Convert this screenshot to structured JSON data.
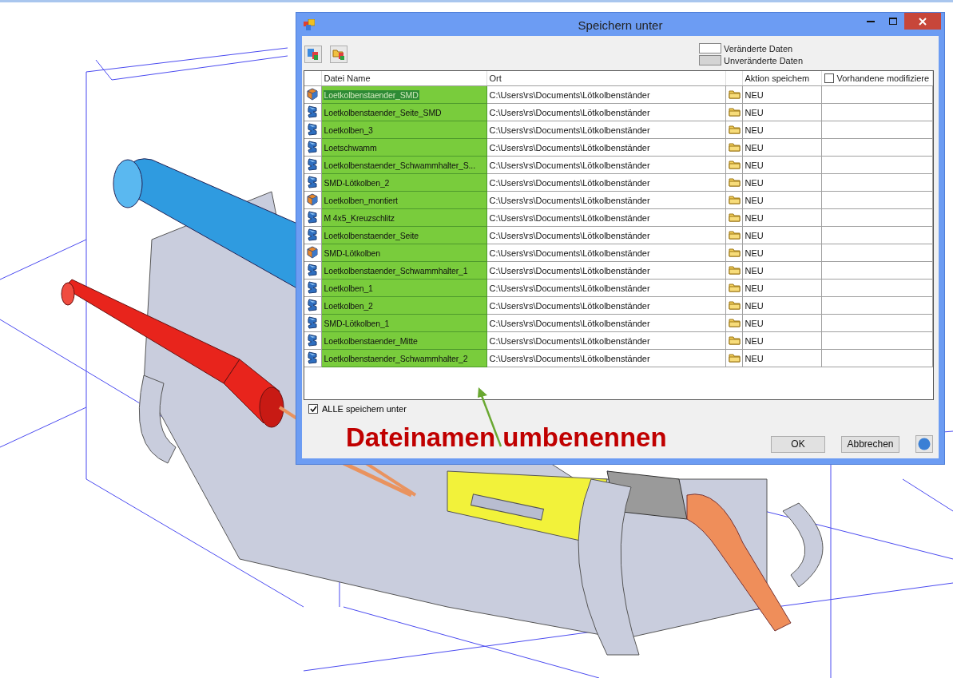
{
  "window": {
    "title": "Speichern unter"
  },
  "legend": [
    {
      "label": "Veränderte Daten",
      "color": "#ffffff"
    },
    {
      "label": "Unveränderte Daten",
      "color": "#d4d4d4"
    }
  ],
  "table": {
    "columns": [
      "Datei Name",
      "Ort",
      "Aktion speichem"
    ],
    "header_checkbox": {
      "label": "Vorhandene modifiziere",
      "checked": false
    },
    "rows": [
      {
        "kind": "assembly",
        "name": "Loetkolbenstaender_SMD",
        "location": "C:\\Users\\rs\\Documents\\Lötkolbenständer",
        "action": "NEU",
        "selected": true
      },
      {
        "kind": "part",
        "name": "Loetkolbenstaender_Seite_SMD",
        "location": "C:\\Users\\rs\\Documents\\Lötkolbenständer",
        "action": "NEU",
        "selected": false
      },
      {
        "kind": "part",
        "name": "Loetkolben_3",
        "location": "C:\\Users\\rs\\Documents\\Lötkolbenständer",
        "action": "NEU",
        "selected": false
      },
      {
        "kind": "part",
        "name": "Loetschwamm",
        "location": "C:\\Users\\rs\\Documents\\Lötkolbenständer",
        "action": "NEU",
        "selected": false
      },
      {
        "kind": "part",
        "name": "Loetkolbenstaender_Schwammhalter_S...",
        "location": "C:\\Users\\rs\\Documents\\Lötkolbenständer",
        "action": "NEU",
        "selected": false
      },
      {
        "kind": "part",
        "name": "SMD-Lötkolben_2",
        "location": "C:\\Users\\rs\\Documents\\Lötkolbenständer",
        "action": "NEU",
        "selected": false
      },
      {
        "kind": "assembly",
        "name": "Loetkolben_montiert",
        "location": "C:\\Users\\rs\\Documents\\Lötkolbenständer",
        "action": "NEU",
        "selected": false
      },
      {
        "kind": "part",
        "name": "M 4x5_Kreuzschlitz",
        "location": "C:\\Users\\rs\\Documents\\Lötkolbenständer",
        "action": "NEU",
        "selected": false
      },
      {
        "kind": "part",
        "name": "Loetkolbenstaender_Seite",
        "location": "C:\\Users\\rs\\Documents\\Lötkolbenständer",
        "action": "NEU",
        "selected": false
      },
      {
        "kind": "assembly",
        "name": "SMD-Lötkolben",
        "location": "C:\\Users\\rs\\Documents\\Lötkolbenständer",
        "action": "NEU",
        "selected": false
      },
      {
        "kind": "part",
        "name": "Loetkolbenstaender_Schwammhalter_1",
        "location": "C:\\Users\\rs\\Documents\\Lötkolbenständer",
        "action": "NEU",
        "selected": false
      },
      {
        "kind": "part",
        "name": "Loetkolben_1",
        "location": "C:\\Users\\rs\\Documents\\Lötkolbenständer",
        "action": "NEU",
        "selected": false
      },
      {
        "kind": "part",
        "name": "Loetkolben_2",
        "location": "C:\\Users\\rs\\Documents\\Lötkolbenständer",
        "action": "NEU",
        "selected": false
      },
      {
        "kind": "part",
        "name": "SMD-Lötkolben_1",
        "location": "C:\\Users\\rs\\Documents\\Lötkolbenständer",
        "action": "NEU",
        "selected": false
      },
      {
        "kind": "part",
        "name": "Loetkolbenstaender_Mitte",
        "location": "C:\\Users\\rs\\Documents\\Lötkolbenständer",
        "action": "NEU",
        "selected": false
      },
      {
        "kind": "part",
        "name": "Loetkolbenstaender_Schwammhalter_2",
        "location": "C:\\Users\\rs\\Documents\\Lötkolbenständer",
        "action": "NEU",
        "selected": false
      }
    ]
  },
  "save_all": {
    "label": "ALLE speichern unter",
    "checked": true
  },
  "annotation": {
    "text": "Dateinamen umbenennen"
  },
  "buttons": [
    "OK",
    "Abbrechen"
  ]
}
